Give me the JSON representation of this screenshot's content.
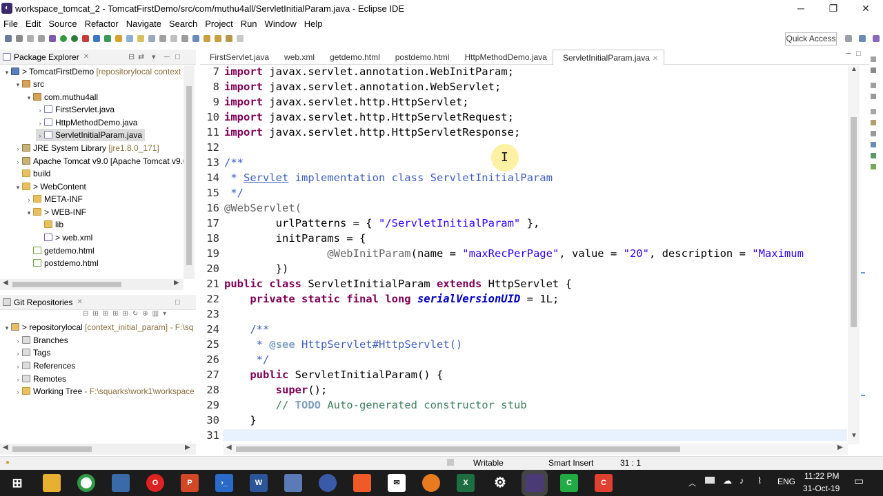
{
  "window": {
    "title": "workspace_tomcat_2 - TomcatFirstDemo/src/com/muthu4all/ServletInitialParam.java - Eclipse IDE",
    "minimize": "─",
    "maximize": "❐",
    "close": "✕"
  },
  "menu": [
    "File",
    "Edit",
    "Source",
    "Refactor",
    "Navigate",
    "Search",
    "Project",
    "Run",
    "Window",
    "Help"
  ],
  "toolbar": {
    "quick_access": "Quick Access"
  },
  "package_explorer": {
    "title": "Package Explorer",
    "items": [
      {
        "label": "> TomcatFirstDemo",
        "deco": " [repositorylocal context"
      },
      {
        "label": "src",
        "deco": ""
      },
      {
        "label": "com.muthu4all",
        "deco": ""
      },
      {
        "label": "FirstServlet.java",
        "deco": ""
      },
      {
        "label": "HttpMethodDemo.java",
        "deco": ""
      },
      {
        "label": "ServletInitialParam.java",
        "deco": ""
      },
      {
        "label": "JRE System Library",
        "deco": " [jre1.8.0_171]"
      },
      {
        "label": "Apache Tomcat v9.0 [Apache Tomcat v9.0",
        "deco": ""
      },
      {
        "label": "build",
        "deco": ""
      },
      {
        "label": "> WebContent",
        "deco": ""
      },
      {
        "label": "META-INF",
        "deco": ""
      },
      {
        "label": "> WEB-INF",
        "deco": ""
      },
      {
        "label": "lib",
        "deco": ""
      },
      {
        "label": "> web.xml",
        "deco": ""
      },
      {
        "label": "getdemo.html",
        "deco": ""
      },
      {
        "label": "postdemo.html",
        "deco": ""
      }
    ]
  },
  "git_repositories": {
    "title": "Git Repositories",
    "items": [
      {
        "label": "> repositorylocal",
        "deco": " [context_initial_param] - F:\\sq"
      },
      {
        "label": "Branches",
        "deco": ""
      },
      {
        "label": "Tags",
        "deco": ""
      },
      {
        "label": "References",
        "deco": ""
      },
      {
        "label": "Remotes",
        "deco": ""
      },
      {
        "label": "Working Tree",
        "deco": " - F:\\squarks\\work1\\workspace"
      }
    ]
  },
  "editor": {
    "tabs": [
      "FirstServlet.java",
      "web.xml",
      "getdemo.html",
      "postdemo.html",
      "HttpMethodDemo.java",
      "ServletInitialParam.java"
    ],
    "active_tab": "ServletInitialParam.java",
    "line_numbers": [
      "7",
      "8",
      "9",
      "10",
      "11",
      "12",
      "13",
      "14",
      "15",
      "16",
      "17",
      "18",
      "19",
      "20",
      "21",
      "22",
      "23",
      "24",
      "25",
      "26",
      "27",
      "28",
      "29",
      "30",
      "31"
    ],
    "t": {
      "import": "import",
      "l7": " javax.servlet.annotation.WebInitParam;",
      "l8": " javax.servlet.annotation.WebServlet;",
      "l9": " javax.servlet.http.HttpServlet;",
      "l10": " javax.servlet.http.HttpServletRequest;",
      "l11": " javax.servlet.http.HttpServletResponse;",
      "l13": "/**",
      "l14a": " * ",
      "l14b": "Servlet",
      "l14c": " implementation class ServletInitialParam",
      "l15": " */",
      "l16": "@WebServlet(",
      "l17a": "        urlPatterns = { ",
      "l17b": "\"/ServletInitialParam\"",
      "l17c": " },",
      "l18": "        initParams = {",
      "l19a": "                ",
      "l19b": "@WebInitParam",
      "l19c": "(name = ",
      "l19d": "\"maxRecPerPage\"",
      "l19e": ", value = ",
      "l19f": "\"20\"",
      "l19g": ", description = ",
      "l19h": "\"Maximum",
      "l20": "        })",
      "l21a": "public class",
      "l21b": " ServletInitialParam ",
      "l21c": "extends",
      "l21d": " HttpServlet {",
      "l22a": "    ",
      "l22b": "private static final long",
      "l22c": " ",
      "l22d": "serialVersionUID",
      "l22e": " = 1L;",
      "l24": "    /**",
      "l25a": "     * ",
      "l25b": "@see",
      "l25c": " HttpServlet#HttpServlet()",
      "l26": "     */",
      "l27a": "    ",
      "l27b": "public",
      "l27c": " ServletInitialParam() {",
      "l28a": "        ",
      "l28b": "super",
      "l28c": "();",
      "l29a": "        // ",
      "l29b": "TODO",
      "l29c": " Auto-generated constructor stub",
      "l30": "    }"
    }
  },
  "status_bar": {
    "mode": "Writable",
    "insert": "Smart Insert",
    "position": "31 : 1"
  },
  "taskbar": {
    "time": "11:22 PM",
    "date": "31-Oct-19",
    "lang": "ENG"
  }
}
